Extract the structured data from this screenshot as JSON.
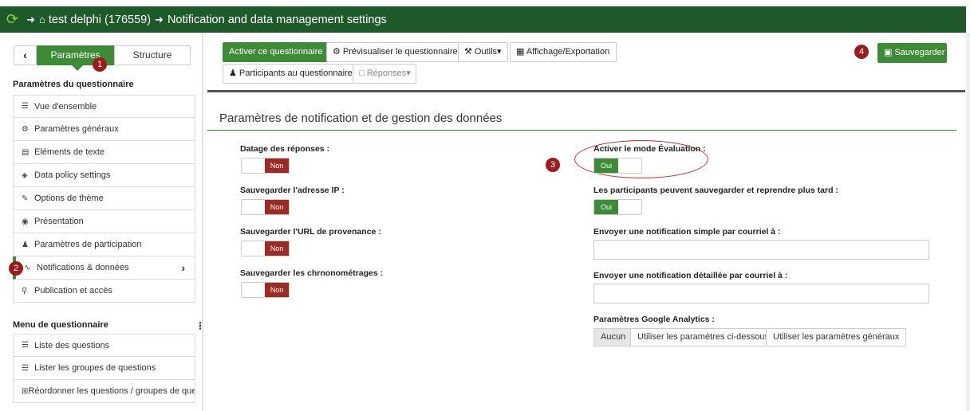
{
  "topbar": {
    "survey": "test delphi (176559)",
    "page": "Notification and data management settings"
  },
  "sidebar": {
    "tab_params": "Paramètres",
    "tab_structure": "Structure",
    "section1": "Paramètres du questionnaire",
    "items": [
      {
        "label": "Vue d'ensemble",
        "icon": "list-icon"
      },
      {
        "label": "Paramètres généraux",
        "icon": "gears-icon"
      },
      {
        "label": "Eléments de texte",
        "icon": "file-text-icon"
      },
      {
        "label": "Data policy settings",
        "icon": "shield-icon"
      },
      {
        "label": "Options de thème",
        "icon": "brush-icon"
      },
      {
        "label": "Présentation",
        "icon": "eye-slash-icon"
      },
      {
        "label": "Paramètres de participation",
        "icon": "users-icon"
      },
      {
        "label": "Notifications & données",
        "icon": "feed-icon"
      },
      {
        "label": "Publication et accès",
        "icon": "key-icon"
      }
    ],
    "section2": "Menu de questionnaire",
    "menu_items": [
      {
        "label": "Liste des questions",
        "icon": "list-icon"
      },
      {
        "label": "Lister les groupes de questions",
        "icon": "list-icon"
      },
      {
        "label": "Réordonner les questions / groupes de quest",
        "icon": "reorder-icon"
      }
    ]
  },
  "toolbar": {
    "activate": "Activer ce questionnaire",
    "preview": "Prévisualiser le questionnaire",
    "tools": "Outils",
    "display_export": "Affichage/Exportation",
    "participants": "Participants au questionnaire",
    "responses": "Réponses",
    "save": "Sauvegarder"
  },
  "content": {
    "title": "Paramètres de notification et de gestion des données",
    "left_fields": [
      {
        "label": "Datage des réponses :",
        "value": "Non"
      },
      {
        "label": "Sauvegarder l'adresse IP :",
        "value": "Non"
      },
      {
        "label": "Sauvegarder l'URL de provenance :",
        "value": "Non"
      },
      {
        "label": "Sauvegarder les chrnonométrages :",
        "value": "Non"
      }
    ],
    "right_fields": {
      "assessment_label": "Activer le mode Évaluation :",
      "assessment_value": "Oui",
      "resume_label": "Les participants peuvent sauvegarder et reprendre plus tard :",
      "resume_value": "Oui",
      "basic_email_label": "Envoyer une notification simple par courriel à :",
      "detailed_email_label": "Envoyer une notification détaillée par courriel à :",
      "ga_label": "Paramètres Google Analytics :",
      "ga_options": [
        "Aucun",
        "Utiliser les paramètres ci-dessous",
        "Utiliser les paramètres généraux"
      ],
      "ga_selected": "Aucun"
    }
  },
  "badges": [
    "1",
    "2",
    "3",
    "4"
  ],
  "colors": {
    "topbar": "#1e5a29",
    "accent": "#3d8b37",
    "danger": "#9b2b24",
    "badge": "#9b1c1c"
  }
}
